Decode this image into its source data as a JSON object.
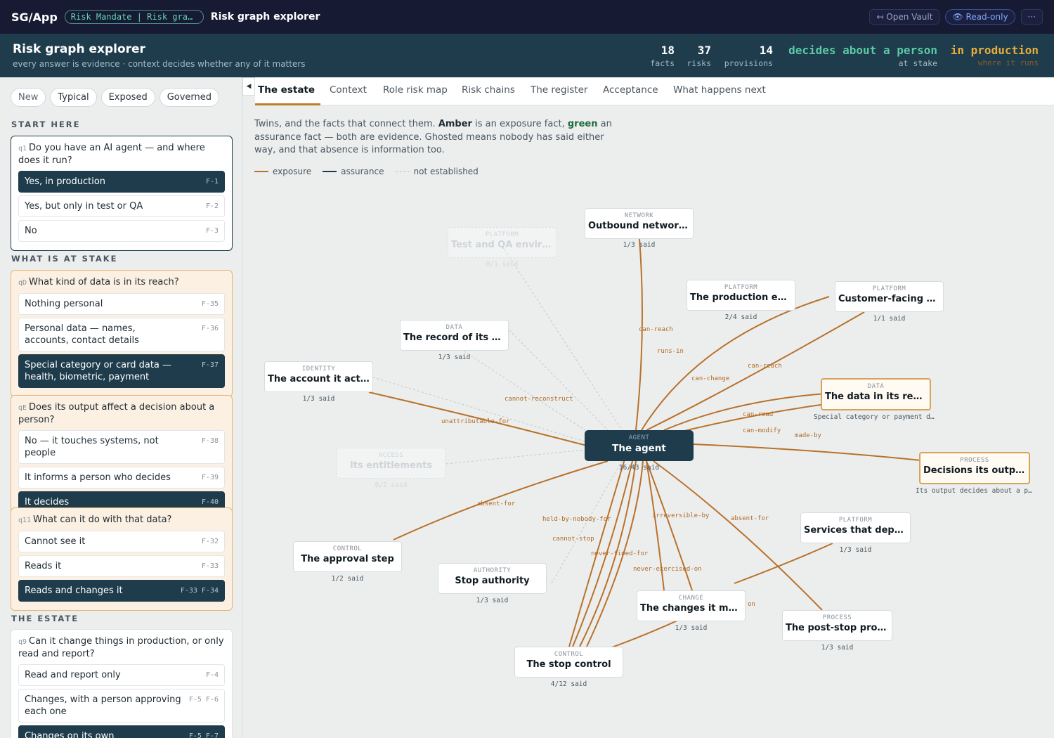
{
  "topbar": {
    "brand": "SG/App",
    "breadcrumb": "Risk Mandate | Risk graph explorer",
    "title": "Risk graph explorer",
    "open_vault": "↤ Open Vault",
    "read_only": "👁 Read-only",
    "more": "···"
  },
  "header": {
    "title": "Risk graph explorer",
    "subtitle": "every answer is evidence · context decides whether any of it matters",
    "stats": [
      {
        "value": "18",
        "label": "facts"
      },
      {
        "value": "37",
        "label": "risks"
      },
      {
        "value": "14",
        "label": "provisions"
      }
    ],
    "stake": {
      "value": "decides about a person",
      "label": "at stake"
    },
    "where": {
      "value": "in production",
      "label": "where it runs"
    }
  },
  "left": {
    "pills": [
      "New",
      "Typical",
      "Exposed",
      "Governed"
    ],
    "sections": {
      "start": "START HERE",
      "stake": "WHAT IS AT STAKE",
      "estate": "THE ESTATE"
    },
    "questions": [
      {
        "id": "q1",
        "text": "Do you have an AI agent — and where does it run?",
        "options": [
          {
            "label": "Yes, in production",
            "ref": "F-1"
          },
          {
            "label": "Yes, but only in test or QA",
            "ref": "F-2"
          },
          {
            "label": "No",
            "ref": "F-3"
          }
        ]
      },
      {
        "id": "qD",
        "text": "What kind of data is in its reach?",
        "options": [
          {
            "label": "Nothing personal",
            "ref": "F-35"
          },
          {
            "label": "Personal data — names, accounts, contact details",
            "ref": "F-36"
          },
          {
            "label": "Special category or card data — health, biometric, payment",
            "ref": "F-37"
          }
        ]
      },
      {
        "id": "qE",
        "text": "Does its output affect a decision about a person?",
        "options": [
          {
            "label": "No — it touches systems, not people",
            "ref": "F-38"
          },
          {
            "label": "It informs a person who decides",
            "ref": "F-39"
          },
          {
            "label": "It decides",
            "ref": "F-40"
          }
        ]
      },
      {
        "id": "q11",
        "text": "What can it do with that data?",
        "options": [
          {
            "label": "Cannot see it",
            "ref": "F-32"
          },
          {
            "label": "Reads it",
            "ref": "F-33"
          },
          {
            "label": "Reads and changes it",
            "ref": "F-33  F-34"
          }
        ]
      },
      {
        "id": "q9",
        "text": "Can it change things in production, or only read and report?",
        "options": [
          {
            "label": "Read and report only",
            "ref": "F-4"
          },
          {
            "label": "Changes, with a person approving each one",
            "ref": "F-5  F-6"
          },
          {
            "label": "Changes on its own",
            "ref": "F-5  F-7"
          }
        ]
      }
    ]
  },
  "tabs": [
    "The estate",
    "Context",
    "Role risk map",
    "Risk chains",
    "The register",
    "Acceptance",
    "What happens next"
  ],
  "intro": {
    "t1": "Twins, and the facts that connect them. ",
    "amber": "Amber",
    "t2": " is an exposure fact, ",
    "green": "green",
    "t3": " an assurance fact — both are evidence. Ghosted means nobody has said either way, and that absence is information too."
  },
  "legend": {
    "exposure": "exposure",
    "assurance": "assurance",
    "not_established": "not established"
  },
  "graph": {
    "agent": {
      "kind": "AGENT",
      "name": "The agent",
      "caption": "16/43 said"
    },
    "nodes": [
      {
        "kind": "NETWORK",
        "name": "Outbound network access",
        "caption": "1/3 said"
      },
      {
        "kind": "PLATFORM",
        "name": "Test and QA environments",
        "caption": "0/1 said"
      },
      {
        "kind": "PLATFORM",
        "name": "The production estate",
        "caption": "2/4 said"
      },
      {
        "kind": "PLATFORM",
        "name": "Customer-facing systems",
        "caption": "1/1 said"
      },
      {
        "kind": "DATA",
        "name": "The record of its actions",
        "caption": "1/3 said"
      },
      {
        "kind": "IDENTITY",
        "name": "The account it acts as",
        "caption": "1/3 said"
      },
      {
        "kind": "DATA",
        "name": "The data in its reach",
        "caption": "Special category or payment data"
      },
      {
        "kind": "ACCESS",
        "name": "Its entitlements",
        "caption": "0/2 said"
      },
      {
        "kind": "PROCESS",
        "name": "Decisions its output drives",
        "caption": "Its output decides about a person"
      },
      {
        "kind": "PLATFORM",
        "name": "Services that depend on it",
        "caption": "1/3 said"
      },
      {
        "kind": "CONTROL",
        "name": "The approval step",
        "caption": "1/2 said"
      },
      {
        "kind": "AUTHORITY",
        "name": "Stop authority",
        "caption": "1/3 said"
      },
      {
        "kind": "CHANGE",
        "name": "The changes it makes",
        "caption": "1/3 said"
      },
      {
        "kind": "PROCESS",
        "name": "The post-stop procedure",
        "caption": "1/3 said"
      },
      {
        "kind": "CONTROL",
        "name": "The stop control",
        "caption": "4/12 said"
      }
    ],
    "edge_labels": [
      "can-reach",
      "runs-in",
      "can-change",
      "can-reach",
      "can-read",
      "can-modify",
      "made-by",
      "cannot-reconstruct",
      "unattributable-for",
      "absent-for",
      "held-by-nobody-for",
      "cannot-stop",
      "never-timed-for",
      "irreversible-by",
      "never-exercised-on",
      "absent-for",
      "on"
    ]
  },
  "colors": {
    "exposure": "#b9712a",
    "assurance": "#1e3c4c",
    "navy": "#161b33",
    "header": "#1e3c4c"
  }
}
